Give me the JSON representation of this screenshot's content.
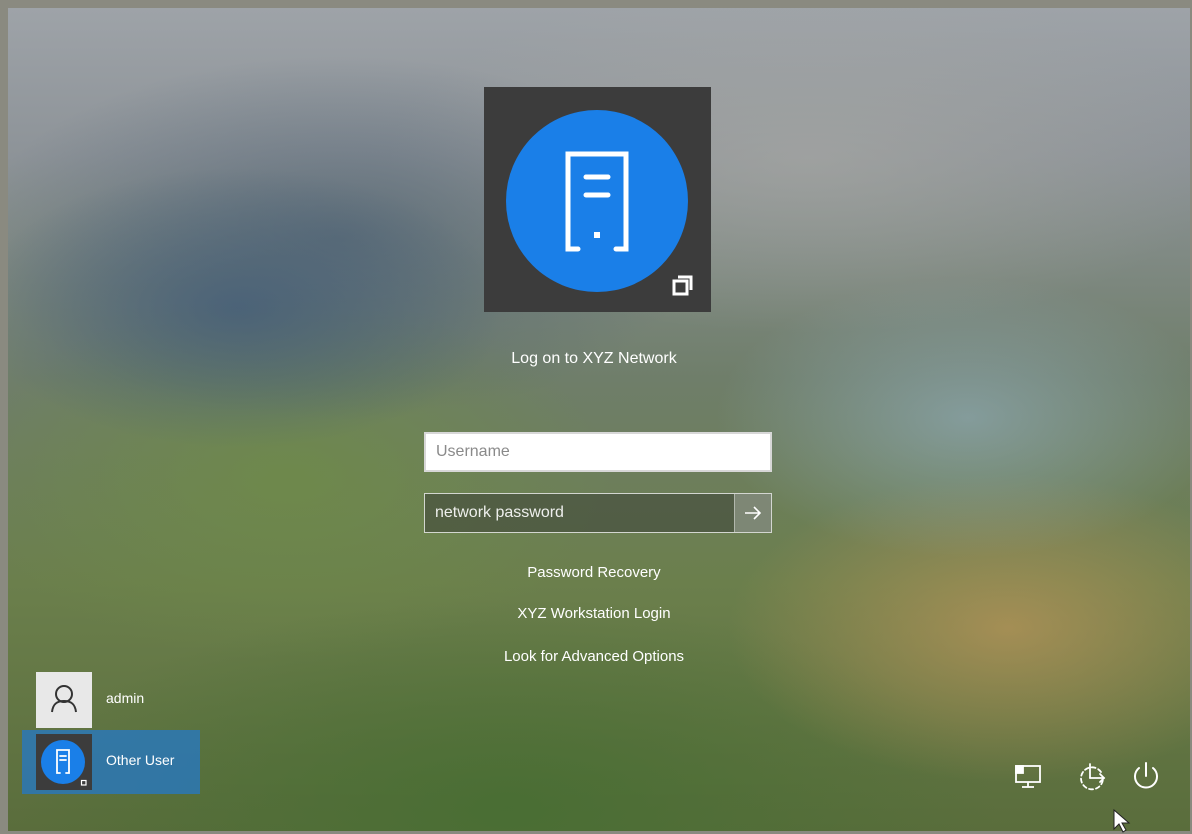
{
  "login": {
    "title": "Log on to XYZ Network",
    "username_placeholder": "Username",
    "password_placeholder": "network password",
    "submit_icon": "arrow-right-icon",
    "links": [
      "Password Recovery",
      "XYZ Workstation Login",
      "Look for Advanced Options"
    ]
  },
  "users": [
    {
      "name": "admin",
      "icon": "person-icon",
      "selected": false
    },
    {
      "name": "Other User",
      "icon": "server-icon",
      "selected": true
    }
  ],
  "tray": {
    "icons": [
      "network-icon",
      "accessibility-icon",
      "power-icon"
    ]
  },
  "colors": {
    "accent_blue": "#1a7fe8",
    "tile_bg": "#3c3c3c",
    "selected_user_bg": "#2878be"
  }
}
